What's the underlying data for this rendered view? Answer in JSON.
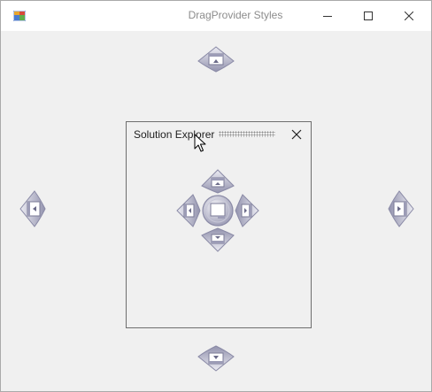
{
  "window": {
    "title": "DragProvider Styles",
    "controls": {
      "minimize_icon": "minimize-icon",
      "maximize_icon": "maximize-icon",
      "close_icon": "close-icon"
    }
  },
  "panel": {
    "title": "Solution Explorer",
    "close_icon": "close-icon"
  },
  "dock_indicators": {
    "outer": [
      "dock-top",
      "dock-left",
      "dock-right",
      "dock-bottom"
    ],
    "center": [
      "dock-center-top",
      "dock-center-left",
      "dock-center-tabbed",
      "dock-center-right",
      "dock-center-bottom"
    ]
  },
  "colors": {
    "indicator_light": "#e4e4ee",
    "indicator_dark": "#8c8ca8",
    "panel_border": "#6e6e6e",
    "window_bg": "#f0f0f0"
  }
}
